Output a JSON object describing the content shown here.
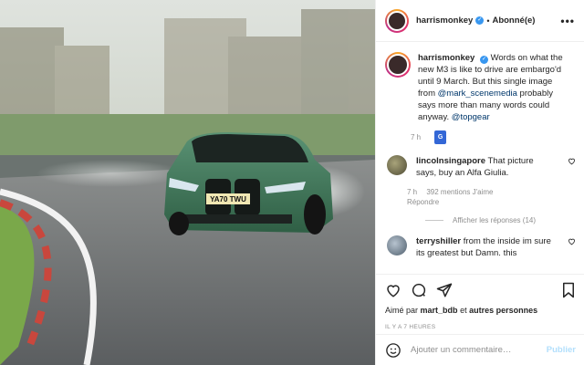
{
  "header": {
    "username": "harrismonkey",
    "follow_label": "Abonné(e)",
    "separator": "•",
    "more_label": "•••"
  },
  "caption": {
    "username": "harrismonkey",
    "text_1": "Words on what the new M3 is like to drive are embargo'd until 9 March. But this single image from",
    "mention_1": "@mark_scenemedia",
    "text_2": "probably says more than many words could anyway.",
    "mention_2": "@topgear",
    "time": "7 h",
    "translate_label": "G"
  },
  "comments": [
    {
      "username": "lincolnsingapore",
      "text": "That picture says, buy an Alfa Giulia.",
      "time": "7 h",
      "likes": "392 mentions J'aime",
      "reply": "Répondre",
      "view_replies": "Afficher les réponses (14)"
    },
    {
      "username": "terryshiller",
      "text": "from the inside im sure its greatest but Damn. this"
    }
  ],
  "likes_line": {
    "prefix": "Aimé par",
    "user": "mart_bdb",
    "joiner": "et",
    "others": "autres personnes"
  },
  "timestamp": "IL Y A 7 HEURES",
  "add_comment": {
    "placeholder": "Ajouter un commentaire…",
    "post_label": "Publier"
  },
  "photo": {
    "plate": "YA70 TWU"
  },
  "colors": {
    "link": "#00376b",
    "verified": "#3897f0",
    "muted": "#8e8e8e",
    "post_disabled": "#b2dffc",
    "car_green": "#3f7a5a"
  }
}
